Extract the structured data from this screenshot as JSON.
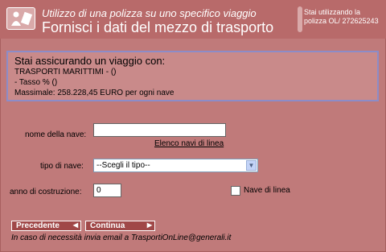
{
  "header": {
    "subtitle": "Utilizzo di una polizza su uno specifico viaggio",
    "title": "Fornisci i dati del mezzo di trasporto",
    "policy_info": "Stai utilizzando la polizza OL/ 272625243",
    "logo_icon": "document-icon"
  },
  "info_box": {
    "lead": "Stai assicurando un viaggio con:",
    "line1": "TRASPORTI MARITTIMI - ()",
    "line2": "- Tasso % ()",
    "line3": "Massimale:  258.228,45 EURO per ogni nave"
  },
  "form": {
    "ship_name_label": "nome della nave:",
    "ship_name_value": "",
    "ship_list_link": "Elenco navi di linea",
    "ship_type_label": "tipo di nave:",
    "ship_type_selected": "--Scegli il tipo--",
    "year_label": "anno di costruzione:",
    "year_value": "0",
    "line_ship_label": "Nave di linea",
    "line_ship_checked": false
  },
  "nav": {
    "prev_label": "Precedente",
    "next_label": "Continua"
  },
  "footer": {
    "text": "In caso di necessità invia email a TrasportiOnLine@generali.it"
  }
}
